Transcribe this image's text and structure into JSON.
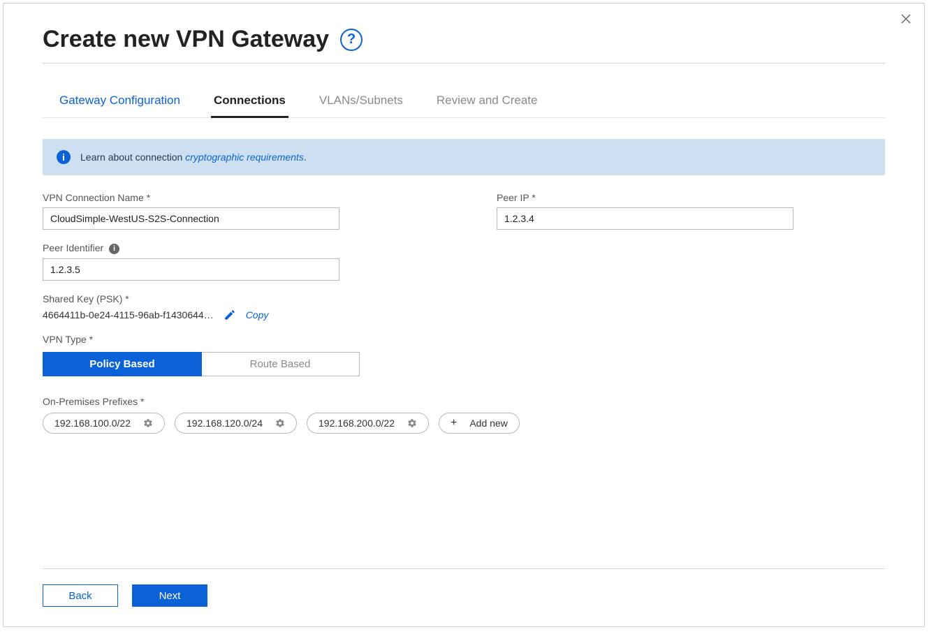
{
  "header": {
    "title": "Create new VPN Gateway",
    "help_icon_title": "Help"
  },
  "tabs": [
    {
      "id": "gateway",
      "label": "Gateway Configuration",
      "state": "available"
    },
    {
      "id": "connections",
      "label": "Connections",
      "state": "active"
    },
    {
      "id": "vlans",
      "label": "VLANs/Subnets",
      "state": "disabled"
    },
    {
      "id": "review",
      "label": "Review and Create",
      "state": "disabled"
    }
  ],
  "banner": {
    "text_prefix": "Learn about connection ",
    "link_text": "cryptographic requirements",
    "text_suffix": "."
  },
  "form": {
    "connection_name": {
      "label": "VPN Connection Name  *",
      "value": "CloudSimple-WestUS-S2S-Connection"
    },
    "peer_ip": {
      "label": "Peer IP  *",
      "value": "1.2.3.4"
    },
    "peer_identifier": {
      "label": "Peer Identifier",
      "value": "1.2.3.5"
    },
    "shared_key": {
      "label": "Shared Key  (PSK) *",
      "value": "4664411b-0e24-4115-96ab-f1430644…",
      "copy_label": "Copy"
    },
    "vpn_type": {
      "label": "VPN Type *",
      "options": [
        "Policy Based",
        "Route Based"
      ],
      "selected": "Policy Based"
    },
    "onprem_prefixes": {
      "label": "On-Premises Prefixes  *",
      "chips": [
        "192.168.100.0/22",
        "192.168.120.0/24",
        "192.168.200.0/22"
      ],
      "add_new_label": "Add new"
    }
  },
  "footer": {
    "back_label": "Back",
    "next_label": "Next"
  }
}
